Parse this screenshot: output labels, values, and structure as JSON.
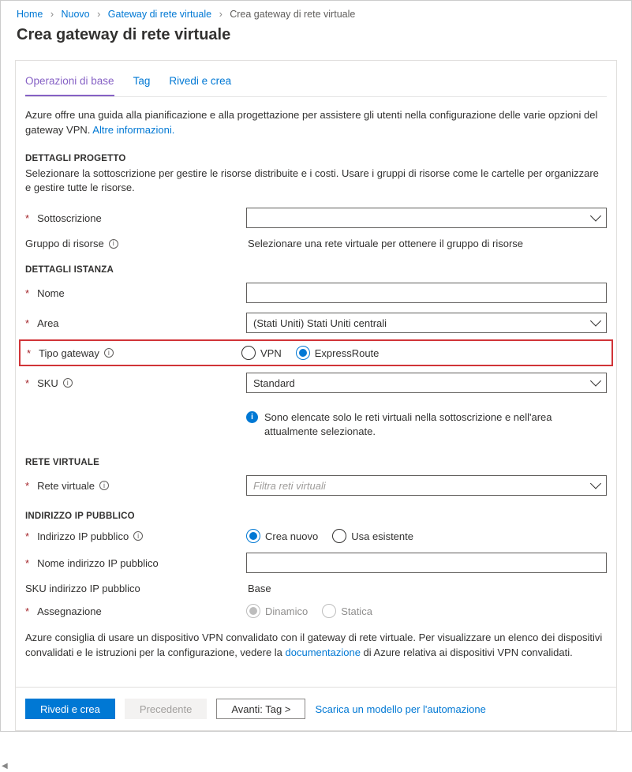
{
  "breadcrumb": {
    "items": [
      "Home",
      "Nuovo",
      "Gateway di rete virtuale"
    ],
    "current": "Crea gateway di rete virtuale"
  },
  "pageTitle": "Crea gateway di rete virtuale",
  "tabs": [
    {
      "label": "Operazioni di base",
      "active": true
    },
    {
      "label": "Tag",
      "active": false
    },
    {
      "label": "Rivedi e crea",
      "active": false
    }
  ],
  "intro": {
    "text": "Azure offre una guida alla pianificazione e alla progettazione per assistere gli utenti nella configurazione delle varie opzioni del gateway VPN. ",
    "link": "Altre informazioni."
  },
  "sections": {
    "project": {
      "header": "DETTAGLI PROGETTO",
      "desc": "Selezionare la sottoscrizione per gestire le risorse distribuite e i costi. Usare i gruppi di risorse come le cartelle per organizzare e gestire tutte le risorse.",
      "subscriptionLabel": "Sottoscrizione",
      "rgLabel": "Gruppo di risorse",
      "rgText": "Selezionare una rete virtuale per ottenere il gruppo di risorse"
    },
    "instance": {
      "header": "DETTAGLI ISTANZA",
      "nameLabel": "Nome",
      "areaLabel": "Area",
      "areaValue": "(Stati Uniti) Stati Uniti centrali",
      "gwTypeLabel": "Tipo gateway",
      "gwOptions": {
        "vpn": "VPN",
        "er": "ExpressRoute"
      },
      "gwSelected": "er",
      "skuLabel": "SKU",
      "skuValue": "Standard",
      "skuInfo": "Sono elencate solo le reti virtuali nella sottoscrizione e nell'area attualmente selezionate."
    },
    "vnet": {
      "header": "RETE VIRTUALE",
      "vnetLabel": "Rete virtuale",
      "vnetPlaceholder": "Filtra reti virtuali"
    },
    "pip": {
      "header": "INDIRIZZO IP PUBBLICO",
      "pipLabel": "Indirizzo IP pubblico",
      "pipOptions": {
        "new": "Crea nuovo",
        "existing": "Usa esistente"
      },
      "pipSelected": "new",
      "pipNameLabel": "Nome indirizzo IP pubblico",
      "pipSkuLabel": "SKU indirizzo IP pubblico",
      "pipSkuValue": "Base",
      "assignLabel": "Assegnazione",
      "assignOptions": {
        "dyn": "Dinamico",
        "stat": "Statica"
      },
      "assignSelected": "dyn"
    }
  },
  "bottomText1": "Azure consiglia di usare un dispositivo VPN convalidato con il gateway di rete virtuale. Per visualizzare un elenco dei dispositivi convalidati e le istruzioni per la configurazione, vedere la ",
  "bottomLink": "documentazione",
  "bottomText2": " di Azure relativa ai dispositivi VPN convalidati.",
  "footer": {
    "review": "Rivedi e crea",
    "prev": "Precedente",
    "next": "Avanti: Tag >",
    "download": "Scarica un modello per l'automazione"
  },
  "scrollHint": "◀"
}
